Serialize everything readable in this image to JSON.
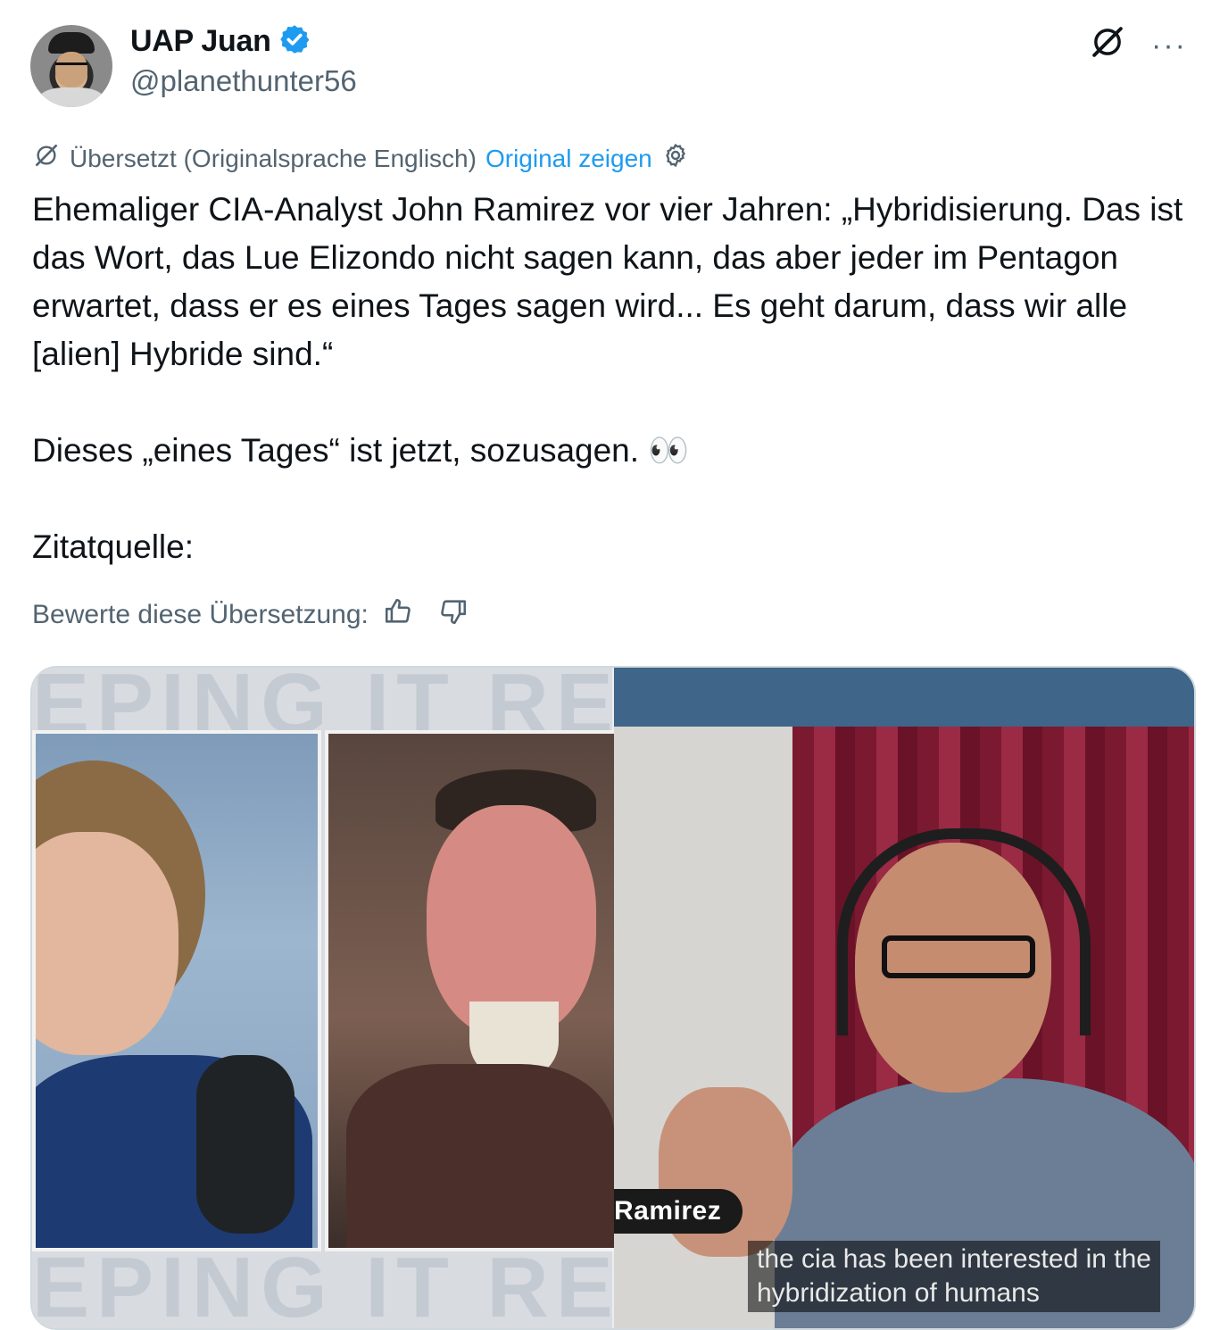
{
  "author": {
    "name": "UAP Juan",
    "handle": "@planethunter56",
    "verified": true
  },
  "header_icons": {
    "grok": "grok-icon",
    "more": "···"
  },
  "translation": {
    "status": "Übersetzt (Originalsprache Englisch)",
    "show_original": "Original zeigen"
  },
  "tweet": {
    "lines": [
      "Ehemaliger CIA-Analyst John Ramirez vor vier Jahren: „Hybridisierung. Das ist das Wort, das Lue Elizondo nicht sagen kann, das aber jeder im Pentagon erwartet, dass er es eines Tages sagen wird... Es geht darum, dass wir alle [alien] Hybride sind.“",
      "Dieses „eines Tages“ ist jetzt, sozusagen. 👀",
      "Zitatquelle:"
    ]
  },
  "rating": {
    "label": "Bewerte diese Übersetzung:"
  },
  "media": {
    "watermark_top": "EPING IT RE",
    "watermark_bottom": "EPING IT RE",
    "name_tag": "Ramirez",
    "caption_line1": "the cia has been interested in the",
    "caption_line2": "hybridization of humans"
  },
  "colors": {
    "accent": "#1d9bf0",
    "muted": "#536471",
    "text": "#0f1419"
  }
}
